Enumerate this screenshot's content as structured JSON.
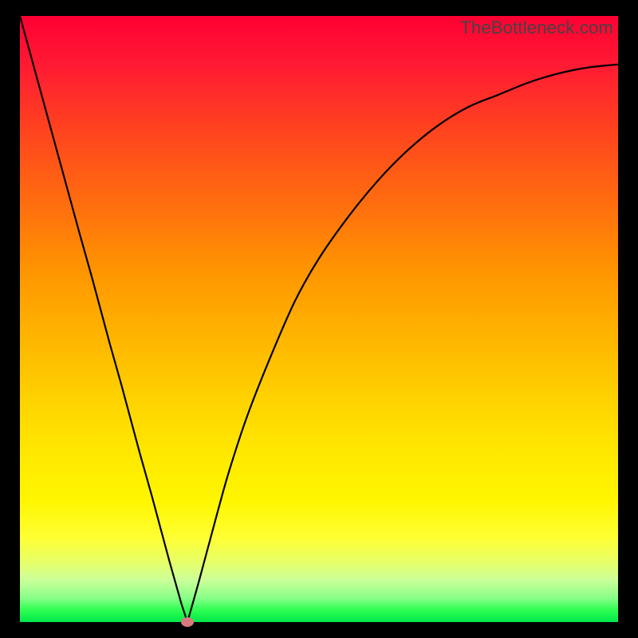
{
  "watermark": "TheBottleneck.com",
  "colors": {
    "frame": "#000000",
    "curve": "#000000",
    "marker": "#d97a7e"
  },
  "chart_data": {
    "type": "line",
    "title": "",
    "xlabel": "",
    "ylabel": "",
    "xlim": [
      0,
      100
    ],
    "ylim": [
      0,
      100
    ],
    "grid": false,
    "annotations": [
      "TheBottleneck.com"
    ],
    "x": [
      0,
      5,
      10,
      12,
      15,
      17,
      20,
      22,
      25,
      27,
      28,
      30,
      33,
      35,
      38,
      42,
      46,
      50,
      55,
      60,
      65,
      70,
      75,
      80,
      85,
      90,
      95,
      100
    ],
    "y": [
      100,
      82,
      64,
      57,
      46,
      39,
      28,
      21,
      10,
      3,
      0,
      7,
      18,
      25,
      34,
      44,
      53,
      60,
      67,
      73,
      78,
      82,
      85,
      87,
      89,
      90.5,
      91.5,
      92
    ],
    "marker": {
      "x": 28,
      "y": 0
    }
  }
}
